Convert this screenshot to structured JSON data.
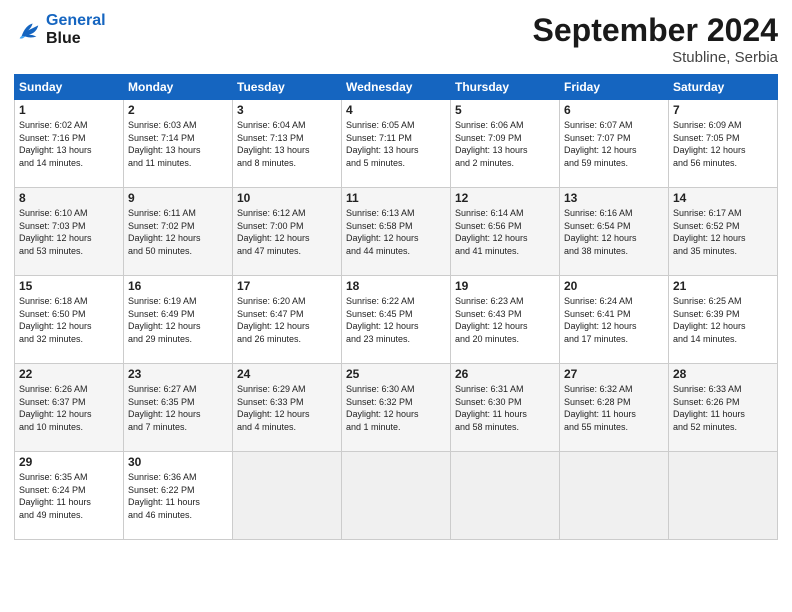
{
  "header": {
    "logo_line1": "General",
    "logo_line2": "Blue",
    "month": "September 2024",
    "location": "Stubline, Serbia"
  },
  "weekdays": [
    "Sunday",
    "Monday",
    "Tuesday",
    "Wednesday",
    "Thursday",
    "Friday",
    "Saturday"
  ],
  "weeks": [
    [
      {
        "day": "1",
        "info": "Sunrise: 6:02 AM\nSunset: 7:16 PM\nDaylight: 13 hours\nand 14 minutes."
      },
      {
        "day": "2",
        "info": "Sunrise: 6:03 AM\nSunset: 7:14 PM\nDaylight: 13 hours\nand 11 minutes."
      },
      {
        "day": "3",
        "info": "Sunrise: 6:04 AM\nSunset: 7:13 PM\nDaylight: 13 hours\nand 8 minutes."
      },
      {
        "day": "4",
        "info": "Sunrise: 6:05 AM\nSunset: 7:11 PM\nDaylight: 13 hours\nand 5 minutes."
      },
      {
        "day": "5",
        "info": "Sunrise: 6:06 AM\nSunset: 7:09 PM\nDaylight: 13 hours\nand 2 minutes."
      },
      {
        "day": "6",
        "info": "Sunrise: 6:07 AM\nSunset: 7:07 PM\nDaylight: 12 hours\nand 59 minutes."
      },
      {
        "day": "7",
        "info": "Sunrise: 6:09 AM\nSunset: 7:05 PM\nDaylight: 12 hours\nand 56 minutes."
      }
    ],
    [
      {
        "day": "8",
        "info": "Sunrise: 6:10 AM\nSunset: 7:03 PM\nDaylight: 12 hours\nand 53 minutes."
      },
      {
        "day": "9",
        "info": "Sunrise: 6:11 AM\nSunset: 7:02 PM\nDaylight: 12 hours\nand 50 minutes."
      },
      {
        "day": "10",
        "info": "Sunrise: 6:12 AM\nSunset: 7:00 PM\nDaylight: 12 hours\nand 47 minutes."
      },
      {
        "day": "11",
        "info": "Sunrise: 6:13 AM\nSunset: 6:58 PM\nDaylight: 12 hours\nand 44 minutes."
      },
      {
        "day": "12",
        "info": "Sunrise: 6:14 AM\nSunset: 6:56 PM\nDaylight: 12 hours\nand 41 minutes."
      },
      {
        "day": "13",
        "info": "Sunrise: 6:16 AM\nSunset: 6:54 PM\nDaylight: 12 hours\nand 38 minutes."
      },
      {
        "day": "14",
        "info": "Sunrise: 6:17 AM\nSunset: 6:52 PM\nDaylight: 12 hours\nand 35 minutes."
      }
    ],
    [
      {
        "day": "15",
        "info": "Sunrise: 6:18 AM\nSunset: 6:50 PM\nDaylight: 12 hours\nand 32 minutes."
      },
      {
        "day": "16",
        "info": "Sunrise: 6:19 AM\nSunset: 6:49 PM\nDaylight: 12 hours\nand 29 minutes."
      },
      {
        "day": "17",
        "info": "Sunrise: 6:20 AM\nSunset: 6:47 PM\nDaylight: 12 hours\nand 26 minutes."
      },
      {
        "day": "18",
        "info": "Sunrise: 6:22 AM\nSunset: 6:45 PM\nDaylight: 12 hours\nand 23 minutes."
      },
      {
        "day": "19",
        "info": "Sunrise: 6:23 AM\nSunset: 6:43 PM\nDaylight: 12 hours\nand 20 minutes."
      },
      {
        "day": "20",
        "info": "Sunrise: 6:24 AM\nSunset: 6:41 PM\nDaylight: 12 hours\nand 17 minutes."
      },
      {
        "day": "21",
        "info": "Sunrise: 6:25 AM\nSunset: 6:39 PM\nDaylight: 12 hours\nand 14 minutes."
      }
    ],
    [
      {
        "day": "22",
        "info": "Sunrise: 6:26 AM\nSunset: 6:37 PM\nDaylight: 12 hours\nand 10 minutes."
      },
      {
        "day": "23",
        "info": "Sunrise: 6:27 AM\nSunset: 6:35 PM\nDaylight: 12 hours\nand 7 minutes."
      },
      {
        "day": "24",
        "info": "Sunrise: 6:29 AM\nSunset: 6:33 PM\nDaylight: 12 hours\nand 4 minutes."
      },
      {
        "day": "25",
        "info": "Sunrise: 6:30 AM\nSunset: 6:32 PM\nDaylight: 12 hours\nand 1 minute."
      },
      {
        "day": "26",
        "info": "Sunrise: 6:31 AM\nSunset: 6:30 PM\nDaylight: 11 hours\nand 58 minutes."
      },
      {
        "day": "27",
        "info": "Sunrise: 6:32 AM\nSunset: 6:28 PM\nDaylight: 11 hours\nand 55 minutes."
      },
      {
        "day": "28",
        "info": "Sunrise: 6:33 AM\nSunset: 6:26 PM\nDaylight: 11 hours\nand 52 minutes."
      }
    ],
    [
      {
        "day": "29",
        "info": "Sunrise: 6:35 AM\nSunset: 6:24 PM\nDaylight: 11 hours\nand 49 minutes."
      },
      {
        "day": "30",
        "info": "Sunrise: 6:36 AM\nSunset: 6:22 PM\nDaylight: 11 hours\nand 46 minutes."
      },
      {
        "day": "",
        "info": ""
      },
      {
        "day": "",
        "info": ""
      },
      {
        "day": "",
        "info": ""
      },
      {
        "day": "",
        "info": ""
      },
      {
        "day": "",
        "info": ""
      }
    ]
  ]
}
